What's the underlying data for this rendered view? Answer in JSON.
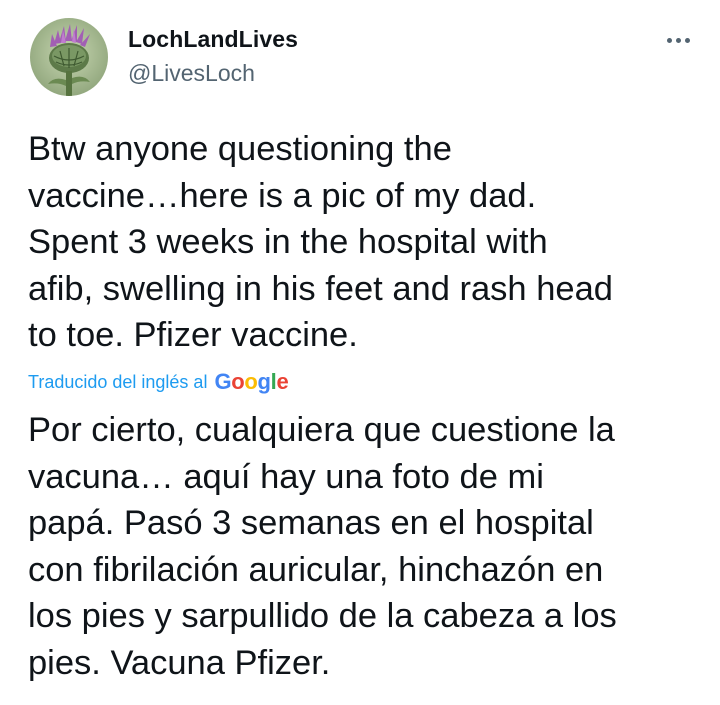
{
  "author": {
    "display_name": "LochLandLives",
    "handle": "@LivesLoch",
    "avatar_icon": "thistle-avatar-icon"
  },
  "more_icon": "more-horizontal-icon",
  "tweet": {
    "text": "Btw anyone questioning the\nvaccine…here is a pic of my dad.\nSpent 3 weeks in the hospital with\nafib, swelling in his feet and rash head\nto toe. Pfizer vaccine.",
    "translation_label": "Traducido del inglés al",
    "translation_provider": "Google",
    "translated_text": "Por cierto, cualquiera que cuestione la\nvacuna… aquí hay una foto de mi\npapá. Pasó 3 semanas en el hospital\ncon fibrilación auricular, hinchazón en\nlos pies y sarpullido de la cabeza a los\npies. Vacuna Pfizer."
  },
  "colors": {
    "text": "#0f1419",
    "secondary": "#536471",
    "link": "#1d9bf0"
  }
}
